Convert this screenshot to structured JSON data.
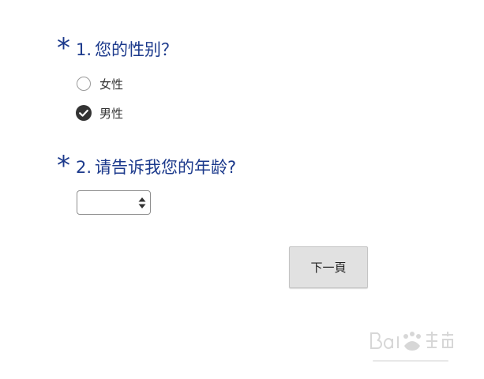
{
  "survey": {
    "questions": [
      {
        "marker": "*",
        "number": "1.",
        "text": "您的性别？",
        "options": [
          {
            "label": "女性",
            "checked": false
          },
          {
            "label": "男性",
            "checked": true
          }
        ]
      },
      {
        "marker": "*",
        "number": "2.",
        "text": "请告诉我您的年龄?",
        "select": {
          "value": ""
        }
      }
    ],
    "next_label": "下一頁"
  },
  "colors": {
    "title": "#1c3a8c",
    "checked": "#333333",
    "button_bg": "#e1e1e1"
  }
}
